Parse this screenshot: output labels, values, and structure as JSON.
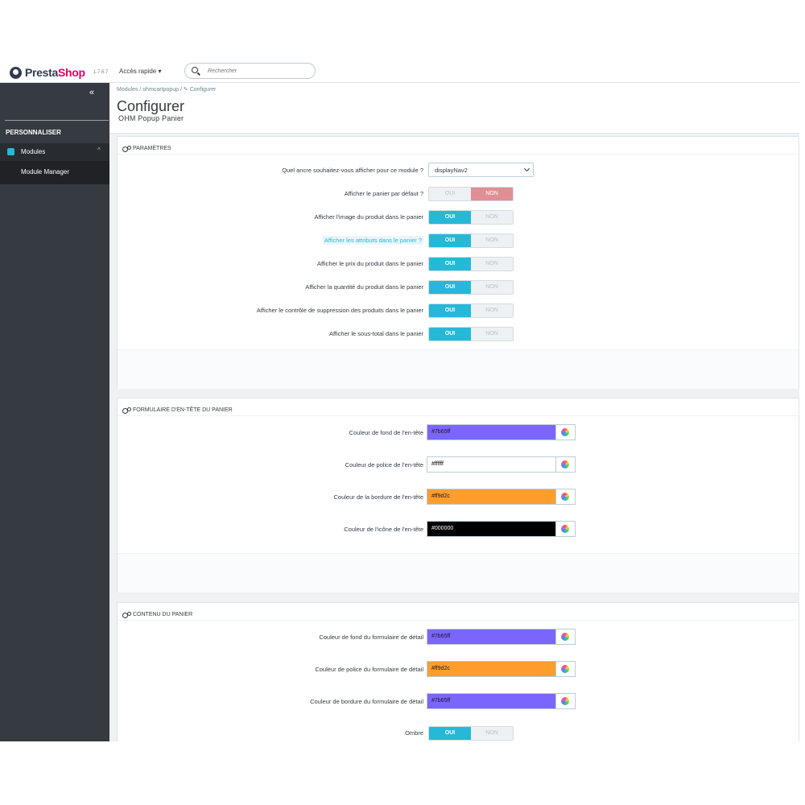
{
  "header": {
    "brand_presta": "Presta",
    "brand_shop": "Shop",
    "version": "1.7.6.7",
    "quick_access": "Accès rapide ▾",
    "search_placeholder": "Rechercher"
  },
  "sidebar": {
    "collapse_glyph": "«",
    "section": "PERSONNALISER",
    "modules_label": "Modules",
    "modules_chevron": "^",
    "module_manager": "Module Manager"
  },
  "page": {
    "breadcrumb": "Modules  /  ohmcartpopup  /  ✎ Configurer",
    "title": "Configurer",
    "subtitle": "OHM Popup Panier"
  },
  "panel1": {
    "title": "PARAMÈTRES",
    "hook_label": "Quel ancre souhaitez-vous afficher pour ce module ?",
    "hook_value": "displayNav2",
    "rows": [
      {
        "label": "Afficher le panier par défaut ?",
        "yes": "OUI",
        "no": "NON",
        "value": "no"
      },
      {
        "label": "Afficher l'image du produit dans le panier",
        "yes": "OUI",
        "no": "NON",
        "value": "yes"
      },
      {
        "label": "Afficher les attributs dans le panier ?",
        "yes": "OUI",
        "no": "NON",
        "value": "yes"
      },
      {
        "label": "Afficher le prix du produit dans le panier",
        "yes": "OUI",
        "no": "NON",
        "value": "yes"
      },
      {
        "label": "Afficher la quantité du produit dans le panier",
        "yes": "OUI",
        "no": "NON",
        "value": "yes"
      },
      {
        "label": "Afficher le contrôle de suppression des produits dans le panier",
        "yes": "OUI",
        "no": "NON",
        "value": "yes"
      },
      {
        "label": "Afficher le sous-total dans le panier",
        "yes": "OUI",
        "no": "NON",
        "value": "yes"
      }
    ]
  },
  "panel2": {
    "title": "FORMULAIRE D'EN-TÊTE DU PANIER",
    "colors": [
      {
        "label": "Couleur de fond de l'en-tête",
        "value": "#7b65ff",
        "bg": "#7b65ff",
        "fg": "#1a1a1a"
      },
      {
        "label": "Couleur de police de l'en-tête",
        "value": "#ffffff",
        "bg": "#ffffff",
        "fg": "#000000"
      },
      {
        "label": "Couleur de la bordure de l'en-tête",
        "value": "#ff9d2c",
        "bg": "#ff9d2c",
        "fg": "#1a1a1a"
      },
      {
        "label": "Couleur de l'icône de l'en-tête",
        "value": "#000000",
        "bg": "#000000",
        "fg": "#ffffff"
      }
    ]
  },
  "panel3": {
    "title": "CONTENU DU PANIER",
    "colors": [
      {
        "label": "Couleur de fond du formulaire de détail",
        "value": "#7b65ff",
        "bg": "#7b65ff",
        "fg": "#1a1a1a"
      },
      {
        "label": "Couleur de police du formulaire de détail",
        "value": "#ff9d2c",
        "bg": "#ff9d2c",
        "fg": "#1a1a1a"
      },
      {
        "label": "Couleur de bordure du formulaire de détail",
        "value": "#7b65ff",
        "bg": "#7b65ff",
        "fg": "#1a1a1a"
      }
    ],
    "shadow": {
      "label": "Ombre",
      "yes": "OUI",
      "no": "NON",
      "value": "yes"
    }
  },
  "colors": {
    "accent": "#25b9d7",
    "toggle_off": "#e08f95",
    "sidebar": "#363a41"
  }
}
